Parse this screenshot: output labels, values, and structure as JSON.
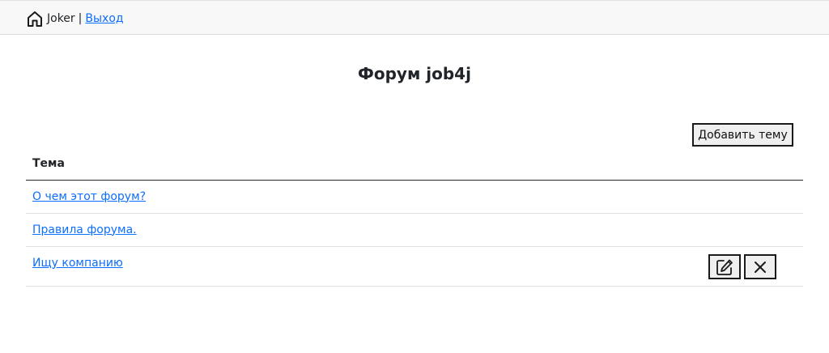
{
  "navbar": {
    "icon": "house-icon",
    "username": "Joker",
    "separator": "|",
    "logout_label": "Выход"
  },
  "page": {
    "title": "Форум job4j"
  },
  "toolbar": {
    "add_topic_label": "Добавить тему"
  },
  "table": {
    "header": "Тема",
    "rows": [
      {
        "title": "О чем этот форум?"
      },
      {
        "title": "Правила форума."
      },
      {
        "title": "Ищу компанию",
        "actions": [
          "edit-icon",
          "close-icon"
        ]
      }
    ]
  },
  "colors": {
    "link": "#0d6efd",
    "navbar_bg": "#f8f8f8",
    "text": "#212529"
  }
}
